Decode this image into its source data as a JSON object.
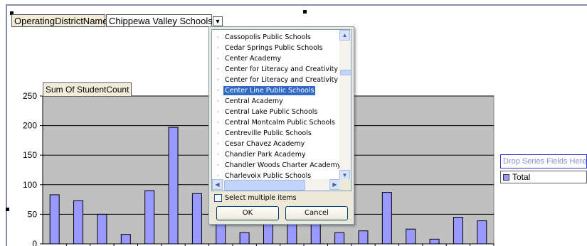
{
  "page_field": {
    "name": "OperatingDistrictName",
    "value": "Chippewa Valley Schools"
  },
  "data_field": {
    "label": "Sum Of StudentCount"
  },
  "series_drop": {
    "label": "Drop Series Fields Here"
  },
  "legend": {
    "label": "Total"
  },
  "colors": {
    "bar": "#9999ff",
    "plot_bg": "#c0c0c0",
    "selection": "#316ac5"
  },
  "dropdown": {
    "items": [
      "Cassopolis Public Schools",
      "Cedar Springs Public Schools",
      "Center Academy",
      "Center for Literacy and Creativity",
      "Center for Literacy and Creativity *",
      "Center Line Public Schools",
      "Central Academy",
      "Central Lake Public Schools",
      "Central Montcalm Public Schools",
      "Centreville Public Schools",
      "Cesar Chavez Academy",
      "Chandler Park Academy",
      "Chandler Woods Charter Academy",
      "Charlevoix Public Schools",
      "Charlevoix-Emmet ISD"
    ],
    "selected_index": 5,
    "select_multiple_label": "Select multiple items",
    "ok_label": "OK",
    "cancel_label": "Cancel"
  },
  "chart_data": {
    "type": "bar",
    "title": "",
    "ylabel": "",
    "xlabel": "",
    "ylim": [
      0,
      250
    ],
    "yticks": [
      "0",
      "50",
      "100",
      "150",
      "200",
      "250"
    ],
    "grid": true,
    "values": [
      83,
      73,
      50,
      16,
      90,
      197,
      85,
      60,
      19,
      35,
      40,
      40,
      19,
      22,
      87,
      25,
      8,
      45,
      39
    ]
  }
}
